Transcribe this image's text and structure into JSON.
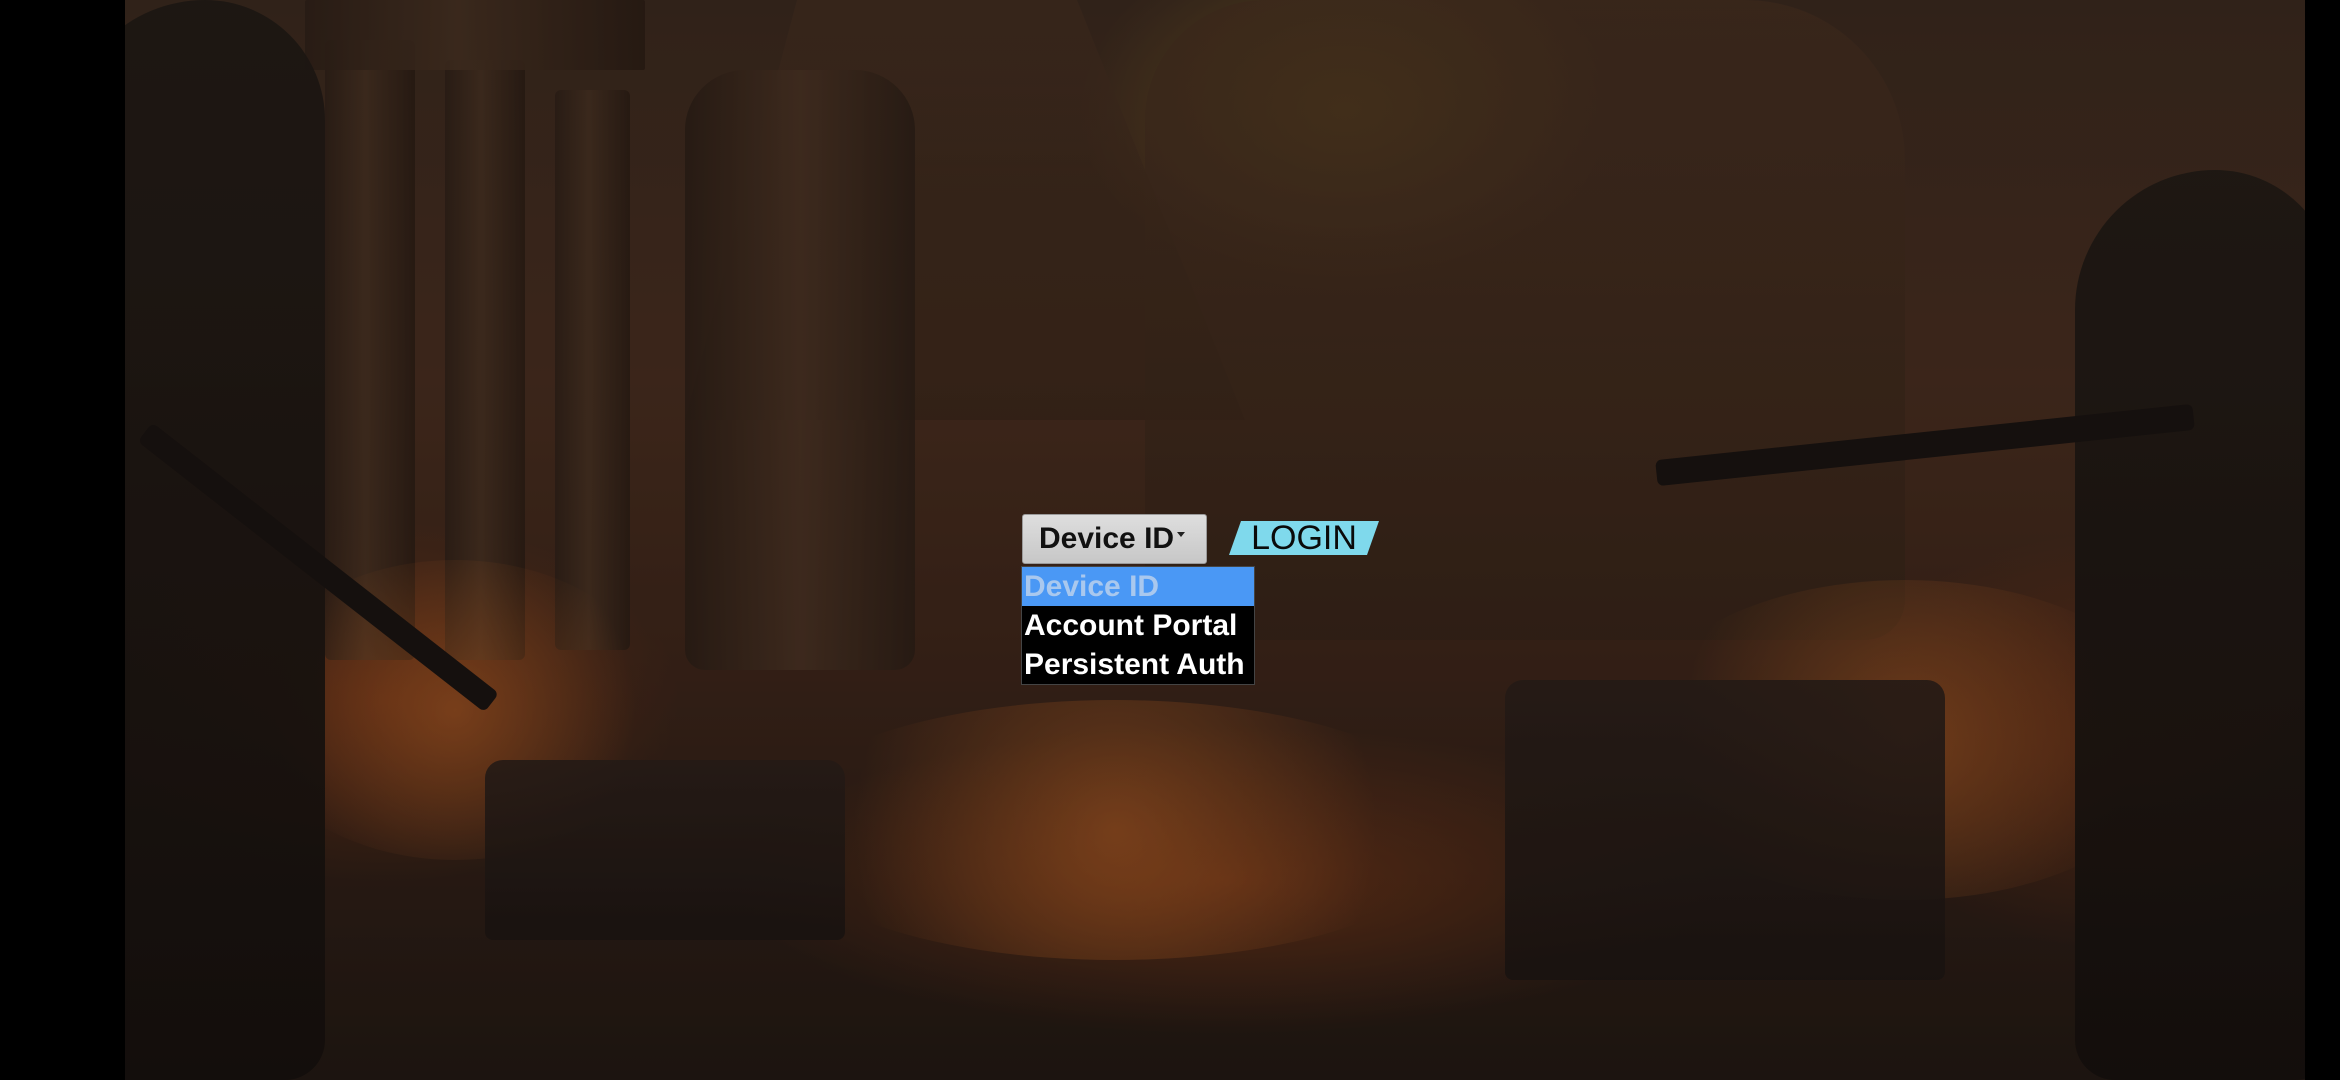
{
  "login": {
    "method_select": {
      "value": "Device ID"
    },
    "login_button_label": "LOGIN",
    "login_button_color": "#7fd9ec",
    "dropdown": {
      "options": [
        {
          "label": "Device ID",
          "selected": true
        },
        {
          "label": "Account Portal",
          "selected": false
        },
        {
          "label": "Persistent Auth",
          "selected": false
        }
      ],
      "selected_bg_color": "#4a98f5"
    }
  }
}
